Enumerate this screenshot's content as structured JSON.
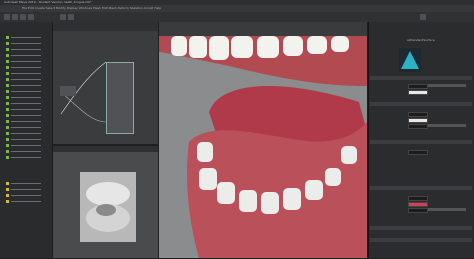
{
  "window": {
    "title": "Autodesk Maya 2019 - Student Version: teeth_tongue.mb*"
  },
  "menu": {
    "label": "File  Edit  Create  Select  Modify  Display  Windows  Mesh  Edit Mesh  Deform  Skeleton  Arnold  Help"
  },
  "attribute_editor": {
    "material_field": "aiStandardSurface",
    "sections": [
      "Base",
      "Specular",
      "Transmission",
      "Subsurface",
      "Emission",
      "Geometry"
    ]
  }
}
